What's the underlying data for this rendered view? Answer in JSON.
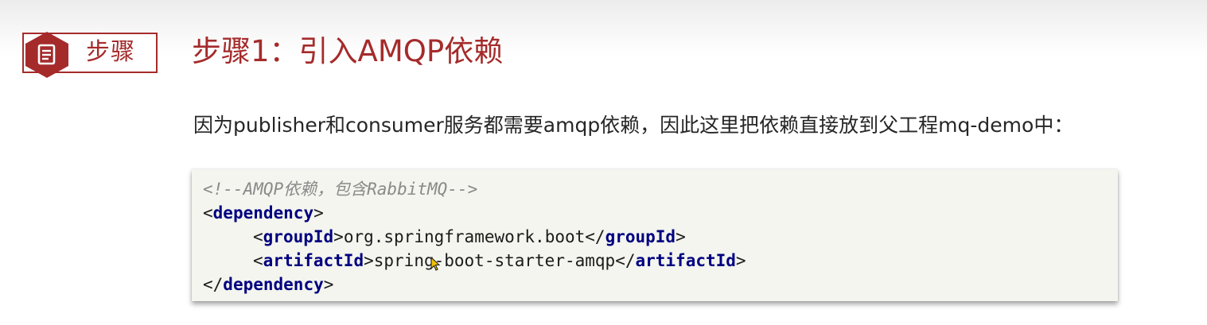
{
  "badge": {
    "label": "步骤",
    "icon": "document-icon",
    "color": "#a52b2b"
  },
  "title": "步骤1：引入AMQP依赖",
  "intro": "因为publisher和consumer服务都需要amqp依赖，因此这里把依赖直接放到父工程mq-demo中：",
  "code": {
    "comment": "<!--AMQP依赖，包含RabbitMQ-->",
    "dependency_tag": "dependency",
    "group_tag": "groupId",
    "group_value": "org.springframework.boot",
    "artifact_tag": "artifactId",
    "artifact_value": "spring-boot-starter-amqp",
    "colors": {
      "background": "#f3f5ee",
      "tag": "#000080",
      "comment": "#8a8a8a"
    }
  },
  "cursor": {
    "icon": "mouse-pointer-icon"
  }
}
